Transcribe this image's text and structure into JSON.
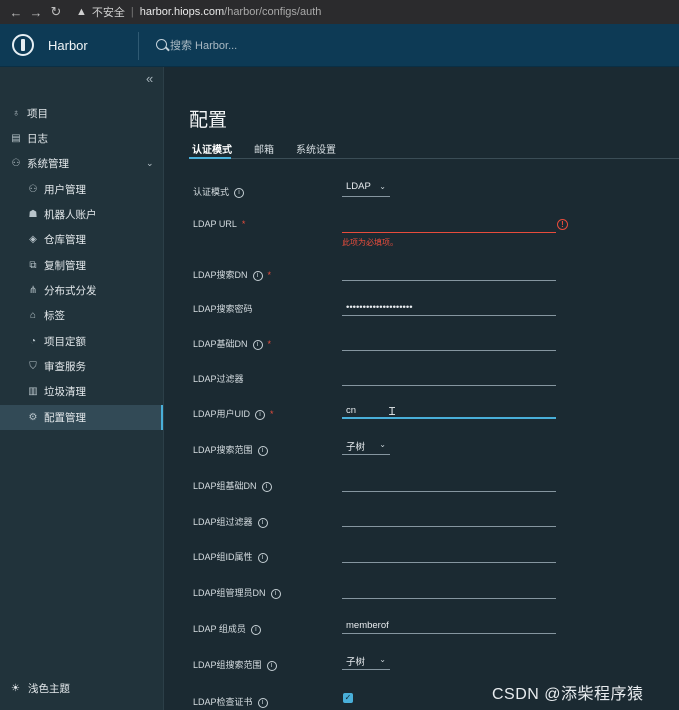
{
  "browser": {
    "insecure_label": "不安全",
    "url_host": "harbor.hiops.com",
    "url_path": "/harbor/configs/auth"
  },
  "header": {
    "brand": "Harbor",
    "search_placeholder": "搜索 Harbor..."
  },
  "sidebar": {
    "collapse_glyph": "«",
    "items": [
      {
        "label": "项目",
        "icon": "projects-icon"
      },
      {
        "label": "日志",
        "icon": "logs-icon"
      },
      {
        "label": "系统管理",
        "icon": "admin-icon"
      }
    ],
    "sub_items": [
      {
        "label": "用户管理",
        "icon": "users-icon"
      },
      {
        "label": "机器人账户",
        "icon": "robot-icon"
      },
      {
        "label": "仓库管理",
        "icon": "registry-icon"
      },
      {
        "label": "复制管理",
        "icon": "replication-icon"
      },
      {
        "label": "分布式分发",
        "icon": "distribution-icon"
      },
      {
        "label": "标签",
        "icon": "tag-icon"
      },
      {
        "label": "项目定额",
        "icon": "quota-icon"
      },
      {
        "label": "审查服务",
        "icon": "shield-icon"
      },
      {
        "label": "垃圾清理",
        "icon": "trash-icon"
      },
      {
        "label": "配置管理",
        "icon": "gear-icon"
      }
    ],
    "theme_label": "浅色主题"
  },
  "main": {
    "title": "配置",
    "tabs": [
      "认证模式",
      "邮箱",
      "系统设置"
    ],
    "form": {
      "auth_mode_label": "认证模式",
      "auth_mode_value": "LDAP",
      "ldap_url_label": "LDAP URL",
      "ldap_url_value": "",
      "ldap_url_error": "此项为必填项。",
      "search_dn_label": "LDAP搜索DN",
      "search_dn_value": "",
      "search_pwd_label": "LDAP搜索密码",
      "search_pwd_value": "••••••••••••••••••••",
      "base_dn_label": "LDAP基础DN",
      "base_dn_value": "",
      "filter_label": "LDAP过滤器",
      "filter_value": "",
      "uid_label": "LDAP用户UID",
      "uid_value": "cn",
      "scope_label": "LDAP搜索范围",
      "scope_value": "子树",
      "group_base_dn_label": "LDAP组基础DN",
      "group_base_dn_value": "",
      "group_filter_label": "LDAP组过滤器",
      "group_filter_value": "",
      "group_id_label": "LDAP组ID属性",
      "group_id_value": "",
      "group_admin_dn_label": "LDAP组管理员DN",
      "group_admin_dn_value": "",
      "group_member_label": "LDAP 组成员",
      "group_member_value": "memberof",
      "group_scope_label": "LDAP组搜索范围",
      "group_scope_value": "子树",
      "verify_cert_label": "LDAP检查证书",
      "verify_cert_checked": true
    }
  },
  "watermark": "CSDN @添柴程序猿"
}
